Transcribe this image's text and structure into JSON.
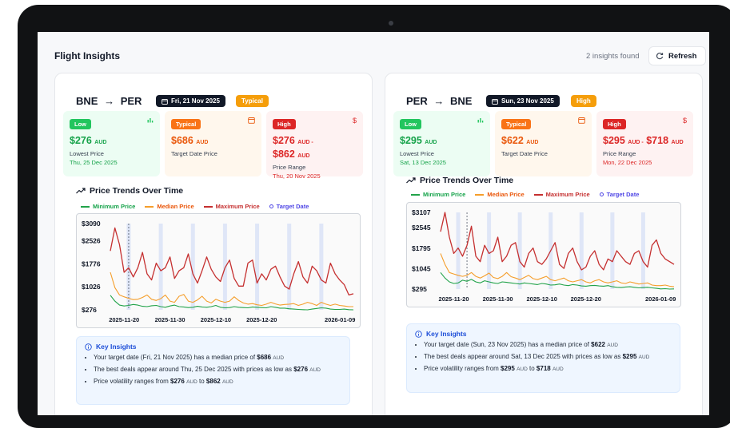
{
  "app": {
    "title": "Flight Insights",
    "insights_count": "2 insights found",
    "refresh_label": "Refresh"
  },
  "cards": [
    {
      "route": {
        "from": "BNE",
        "to": "PER",
        "arrow": "→"
      },
      "date": "Fri, 21 Nov 2025",
      "level": "Typical",
      "low": {
        "badge": "Low",
        "price": "$276",
        "unit": "AUD",
        "label": "Lowest Price",
        "date": "Thu, 25 Dec 2025"
      },
      "typical": {
        "badge": "Typical",
        "price": "$686",
        "unit": "AUD",
        "label": "Target Date Price"
      },
      "high": {
        "badge": "High",
        "price_from": "$276",
        "unit1": "AUD -",
        "price_to": "$862",
        "unit2": "AUD",
        "label": "Price Range",
        "date": "Thu, 20 Nov 2025"
      },
      "trends_title": "Price Trends Over Time",
      "legend": {
        "min": "Minimum Price",
        "median": "Median Price",
        "max": "Maximum Price",
        "target": "Target Date"
      },
      "insights": {
        "title": "Key Insights",
        "i1": {
          "a": "Your target date (Fri, 21 Nov 2025) has a median price of ",
          "b": "$686",
          "u": "AUD"
        },
        "i2": {
          "a": "The best deals appear around Thu, 25 Dec 2025 with prices as low as ",
          "b": "$276",
          "u": "AUD"
        },
        "i3": {
          "a": "Price volatility ranges from ",
          "b1": "$276",
          "u1": "AUD",
          "m": " to ",
          "b2": "$862",
          "u2": "AUD"
        }
      }
    },
    {
      "route": {
        "from": "PER",
        "to": "BNE",
        "arrow": "→"
      },
      "date": "Sun, 23 Nov 2025",
      "level": "High",
      "low": {
        "badge": "Low",
        "price": "$295",
        "unit": "AUD",
        "label": "Lowest Price",
        "date": "Sat, 13 Dec 2025"
      },
      "typical": {
        "badge": "Typical",
        "price": "$622",
        "unit": "AUD",
        "label": "Target Date Price"
      },
      "high": {
        "badge": "High",
        "price_from": "$295",
        "unit1": "AUD -",
        "price_to": "$718",
        "unit2": "AUD",
        "label": "Price Range",
        "date": "Mon, 22 Dec 2025"
      },
      "trends_title": "Price Trends Over Time",
      "legend": {
        "min": "Minimum Price",
        "median": "Median Price",
        "max": "Maximum Price",
        "target": "Target Date"
      },
      "insights": {
        "title": "Key Insights",
        "i1": {
          "a": "Your target date (Sun, 23 Nov 2025) has a median price of ",
          "b": "$622",
          "u": "AUD"
        },
        "i2": {
          "a": "The best deals appear around Sat, 13 Dec 2025 with prices as low as ",
          "b": "$295",
          "u": "AUD"
        },
        "i3": {
          "a": "Price volatility ranges from ",
          "b1": "$295",
          "u1": "AUD",
          "m": " to ",
          "b2": "$718",
          "u2": "AUD"
        }
      }
    }
  ],
  "colors": {
    "min": "#22a34a",
    "median": "#f59e2b",
    "max": "#c53030",
    "target": "#4f46e5",
    "band": "#dfe6f7"
  },
  "chart_data": [
    {
      "type": "line",
      "yticks": [
        3090,
        2526,
        1776,
        1026,
        276
      ],
      "ylim": [
        276,
        3090
      ],
      "xticks": [
        "2025-11-20",
        "2025-11-30",
        "2025-12-10",
        "2025-12-20",
        "2026-01-09"
      ],
      "xrange": [
        "2025-11-17",
        "2026-01-09"
      ],
      "target_date": "2025-11-21",
      "weekends": [
        "2025-11-21",
        "2025-11-28",
        "2025-12-05",
        "2025-12-12",
        "2025-12-19",
        "2025-12-26",
        "2026-01-02"
      ],
      "series": [
        {
          "name": "Minimum Price",
          "values": [
            750,
            560,
            430,
            400,
            420,
            450,
            430,
            390,
            380,
            410,
            420,
            380,
            360,
            400,
            430,
            380,
            370,
            350,
            360,
            390,
            370,
            360,
            380,
            420,
            360,
            340,
            350,
            380,
            360,
            350,
            340,
            370,
            360,
            350,
            340,
            380,
            360,
            330,
            330,
            310,
            300,
            290,
            280,
            276,
            300,
            320,
            340,
            330,
            300,
            290,
            290,
            300,
            280,
            276
          ]
        },
        {
          "name": "Median Price",
          "values": [
            1500,
            1000,
            760,
            700,
            650,
            610,
            620,
            680,
            760,
            620,
            580,
            640,
            760,
            560,
            520,
            720,
            780,
            560,
            520,
            600,
            720,
            560,
            500,
            620,
            560,
            520,
            560,
            700,
            580,
            500,
            460,
            480,
            440,
            420,
            460,
            520,
            470,
            430,
            450,
            460,
            480,
            420,
            460,
            520,
            480,
            420,
            520,
            460,
            420,
            460,
            420,
            400,
            380,
            380
          ]
        },
        {
          "name": "Maximum Price",
          "values": [
            2200,
            2950,
            2400,
            1500,
            1650,
            1350,
            1650,
            2150,
            1450,
            1250,
            1800,
            1550,
            1650,
            2000,
            1300,
            1550,
            1650,
            2100,
            1450,
            1150,
            1550,
            2000,
            1600,
            1350,
            1200,
            1650,
            1900,
            1300,
            1050,
            1050,
            1800,
            1900,
            1150,
            1450,
            1250,
            1600,
            1700,
            1350,
            1050,
            950,
            1450,
            1850,
            1350,
            1150,
            1700,
            1550,
            1250,
            1150,
            1800,
            1450,
            1250,
            1100,
            760,
            800
          ]
        }
      ]
    },
    {
      "type": "line",
      "yticks": [
        3107,
        2545,
        1795,
        1045,
        295
      ],
      "ylim": [
        295,
        3107
      ],
      "xticks": [
        "2025-11-20",
        "2025-11-30",
        "2025-12-10",
        "2025-12-20",
        "2026-01-09"
      ],
      "xrange": [
        "2025-11-17",
        "2026-01-09"
      ],
      "target_date": "2025-11-23",
      "weekends": [
        "2025-11-21",
        "2025-11-28",
        "2025-12-05",
        "2025-12-12",
        "2025-12-19",
        "2025-12-26",
        "2026-01-02"
      ],
      "series": [
        {
          "name": "Minimum Price",
          "values": [
            900,
            700,
            560,
            500,
            520,
            620,
            580,
            650,
            560,
            520,
            600,
            560,
            520,
            500,
            560,
            540,
            520,
            500,
            480,
            520,
            500,
            480,
            460,
            500,
            480,
            440,
            450,
            480,
            440,
            420,
            460,
            440,
            410,
            400,
            420,
            430,
            410,
            400,
            420,
            380,
            360,
            350,
            370,
            380,
            360,
            340,
            350,
            360,
            340,
            320,
            300,
            310,
            295,
            300
          ]
        },
        {
          "name": "Median Price",
          "values": [
            1600,
            1200,
            900,
            850,
            800,
            760,
            800,
            900,
            760,
            700,
            780,
            880,
            720,
            680,
            760,
            900,
            750,
            700,
            640,
            720,
            800,
            680,
            640,
            700,
            760,
            640,
            600,
            650,
            700,
            600,
            560,
            600,
            640,
            560,
            520,
            600,
            640,
            560,
            520,
            560,
            600,
            520,
            500,
            560,
            520,
            480,
            500,
            520,
            440,
            420,
            420,
            440,
            400,
            380
          ]
        },
        {
          "name": "Maximum Price",
          "values": [
            2400,
            3107,
            2200,
            1600,
            1800,
            1500,
            1900,
            2600,
            1500,
            1300,
            1900,
            1600,
            1700,
            2200,
            1300,
            1500,
            1900,
            2000,
            1300,
            1100,
            1600,
            1800,
            1300,
            1200,
            1400,
            1700,
            2000,
            1200,
            1050,
            1600,
            1800,
            1300,
            1000,
            1100,
            1500,
            1700,
            1200,
            1000,
            1400,
            1300,
            1700,
            1500,
            1300,
            1200,
            1600,
            1700,
            1300,
            1100,
            1900,
            2100,
            1600,
            1400,
            1300,
            1200
          ]
        }
      ]
    }
  ]
}
